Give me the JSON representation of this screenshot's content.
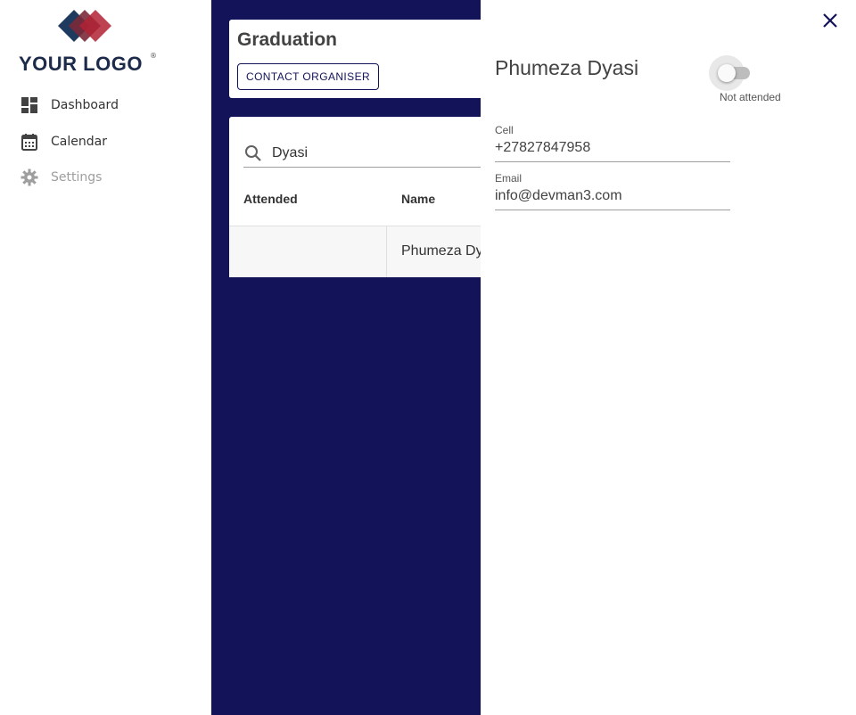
{
  "brand": {
    "logo_text": "YOUR LOGO",
    "logo_mark": "®",
    "colors": [
      "#1f3a5f",
      "#7a2a3a",
      "#b22234"
    ]
  },
  "sidebar": {
    "items": [
      {
        "label": "Dashboard",
        "icon": "dashboard-icon",
        "enabled": true
      },
      {
        "label": "Calendar",
        "icon": "calendar-icon",
        "enabled": true
      },
      {
        "label": "Settings",
        "icon": "gear-icon",
        "enabled": false
      }
    ]
  },
  "event": {
    "title": "Graduation",
    "contact_button": "CONTACT ORGANISER"
  },
  "table": {
    "search_value": "Dyasi",
    "columns": [
      "Attended",
      "Name"
    ],
    "rows": [
      {
        "attended": "",
        "name": "Phumeza Dy"
      }
    ]
  },
  "drawer": {
    "name": "Phumeza Dyasi",
    "toggle_label": "Not attended",
    "attended": false,
    "cell_label": "Cell",
    "cell_value": "+27827847958",
    "email_label": "Email",
    "email_value": "info@devman3.com"
  },
  "colors": {
    "primary": "#13135a",
    "background": "#ffffff"
  }
}
